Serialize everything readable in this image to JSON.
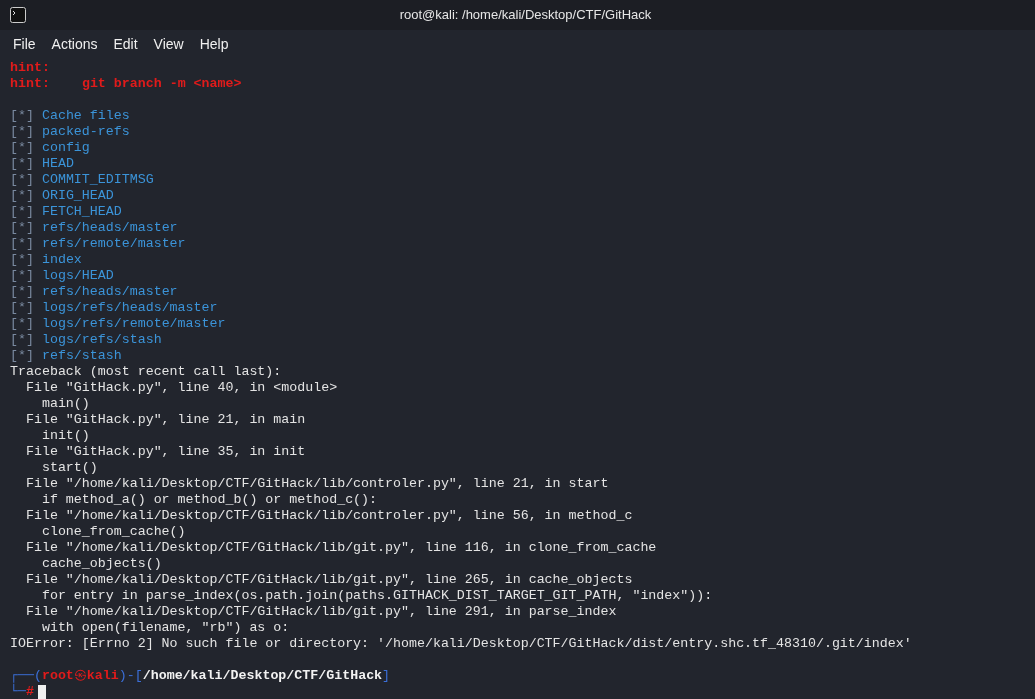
{
  "window": {
    "title": "root@kali: /home/kali/Desktop/CTF/GitHack"
  },
  "menu": [
    "File",
    "Actions",
    "Edit",
    "View",
    "Help"
  ],
  "lines": [
    {
      "kind": "hint",
      "label": "hint:"
    },
    {
      "kind": "hint",
      "label": "hint:",
      "text": "git branch -m <name>"
    },
    {
      "kind": "blank"
    },
    {
      "kind": "status",
      "mark": "[*]",
      "text": "Cache files"
    },
    {
      "kind": "status",
      "mark": "[*]",
      "text": "packed-refs"
    },
    {
      "kind": "status",
      "mark": "[*]",
      "text": "config"
    },
    {
      "kind": "status",
      "mark": "[*]",
      "text": "HEAD"
    },
    {
      "kind": "status",
      "mark": "[*]",
      "text": "COMMIT_EDITMSG"
    },
    {
      "kind": "status",
      "mark": "[*]",
      "text": "ORIG_HEAD"
    },
    {
      "kind": "status",
      "mark": "[*]",
      "text": "FETCH_HEAD"
    },
    {
      "kind": "status",
      "mark": "[*]",
      "text": "refs/heads/master"
    },
    {
      "kind": "status",
      "mark": "[*]",
      "text": "refs/remote/master"
    },
    {
      "kind": "status",
      "mark": "[*]",
      "text": "index"
    },
    {
      "kind": "status",
      "mark": "[*]",
      "text": "logs/HEAD"
    },
    {
      "kind": "status",
      "mark": "[*]",
      "text": "refs/heads/master"
    },
    {
      "kind": "status",
      "mark": "[*]",
      "text": "logs/refs/heads/master"
    },
    {
      "kind": "status",
      "mark": "[*]",
      "text": "logs/refs/remote/master"
    },
    {
      "kind": "status",
      "mark": "[*]",
      "text": "logs/refs/stash"
    },
    {
      "kind": "status",
      "mark": "[*]",
      "text": "refs/stash"
    },
    {
      "kind": "plain",
      "text": "Traceback (most recent call last):"
    },
    {
      "kind": "plain",
      "text": "  File \"GitHack.py\", line 40, in <module>"
    },
    {
      "kind": "plain",
      "text": "    main()"
    },
    {
      "kind": "plain",
      "text": "  File \"GitHack.py\", line 21, in main"
    },
    {
      "kind": "plain",
      "text": "    init()"
    },
    {
      "kind": "plain",
      "text": "  File \"GitHack.py\", line 35, in init"
    },
    {
      "kind": "plain",
      "text": "    start()"
    },
    {
      "kind": "plain",
      "text": "  File \"/home/kali/Desktop/CTF/GitHack/lib/controler.py\", line 21, in start"
    },
    {
      "kind": "plain",
      "text": "    if method_a() or method_b() or method_c():"
    },
    {
      "kind": "plain",
      "text": "  File \"/home/kali/Desktop/CTF/GitHack/lib/controler.py\", line 56, in method_c"
    },
    {
      "kind": "plain",
      "text": "    clone_from_cache()"
    },
    {
      "kind": "plain",
      "text": "  File \"/home/kali/Desktop/CTF/GitHack/lib/git.py\", line 116, in clone_from_cache"
    },
    {
      "kind": "plain",
      "text": "    cache_objects()"
    },
    {
      "kind": "plain",
      "text": "  File \"/home/kali/Desktop/CTF/GitHack/lib/git.py\", line 265, in cache_objects"
    },
    {
      "kind": "plain",
      "text": "    for entry in parse_index(os.path.join(paths.GITHACK_DIST_TARGET_GIT_PATH, \"index\")):"
    },
    {
      "kind": "plain",
      "text": "  File \"/home/kali/Desktop/CTF/GitHack/lib/git.py\", line 291, in parse_index"
    },
    {
      "kind": "plain",
      "text": "    with open(filename, \"rb\") as o:"
    },
    {
      "kind": "plain",
      "text": "IOError: [Errno 2] No such file or directory: '/home/kali/Desktop/CTF/GitHack/dist/entry.shc.tf_48310/.git/index'"
    },
    {
      "kind": "blank"
    }
  ],
  "prompt": {
    "open": "┌──(",
    "user": "root",
    "at": "㉿",
    "host": "kali",
    "mid": ")-[",
    "path": "/home/kali/Desktop/CTF/GitHack",
    "close": "]",
    "corner": "└─",
    "symbol": "#"
  }
}
